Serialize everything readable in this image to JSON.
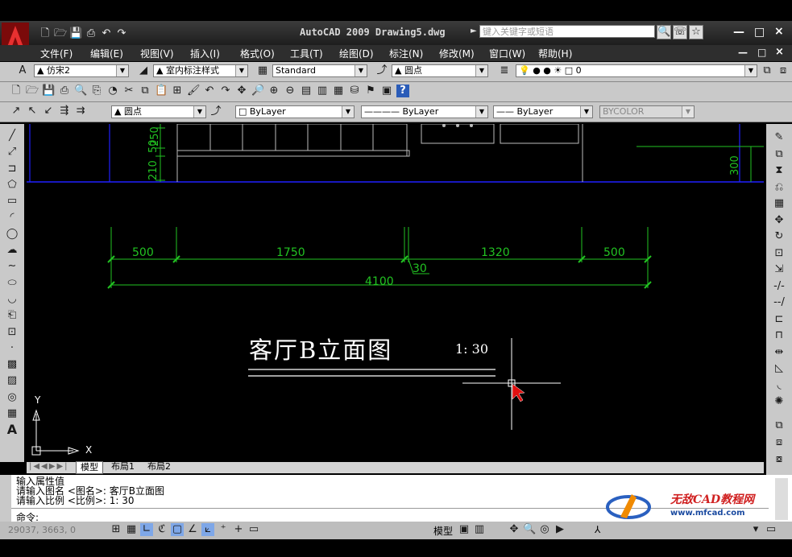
{
  "window": {
    "title": "AutoCAD 2009 Drawing5.dwg",
    "search_placeholder": "键入关键字或短语",
    "min": "—",
    "max": "□",
    "close": "×"
  },
  "menu": [
    "文件(F)",
    "编辑(E)",
    "视图(V)",
    "插入(I)",
    "格式(O)",
    "工具(T)",
    "绘图(D)",
    "标注(N)",
    "修改(M)",
    "窗口(W)",
    "帮助(H)"
  ],
  "toolbar_styles": {
    "text_style": "仿宋2",
    "dim_style": "室内标注样式",
    "table_style": "Standard",
    "multileader_style": "圆点",
    "layer": "0"
  },
  "toolbar_props": {
    "mleader": "圆点",
    "color": "ByLayer",
    "linetype": "ByLayer",
    "lineweight": "ByLayer",
    "plotstyle": "BYCOLOR"
  },
  "drawing": {
    "dims_top": {
      "left": "50",
      "left2": "250",
      "left3": "210",
      "right": "300"
    },
    "dims": [
      "500",
      "1750",
      "1320",
      "500"
    ],
    "dim_small": "30",
    "dim_total": "4100",
    "caption": "客厅B立面图",
    "scale": "1: 30",
    "ucs_x": "X",
    "ucs_y": "Y"
  },
  "tabs": [
    "模型",
    "布局1",
    "布局2"
  ],
  "command": {
    "lines": [
      "输入属性值",
      "请输入图名 <图名>: 客厅B立面图",
      "请输入比例 <比例>: 1: 30"
    ],
    "prompt": "命令:"
  },
  "status": {
    "coords": "29037, 3663, 0",
    "model": "模型",
    "watermark_name": "无敌CAD教程网",
    "watermark_url": "www.mfcad.com"
  },
  "colors": {
    "dim_green": "#22c322",
    "blue_line": "#2020ff",
    "white": "#ffffff",
    "red_cursor": "#e01010"
  }
}
